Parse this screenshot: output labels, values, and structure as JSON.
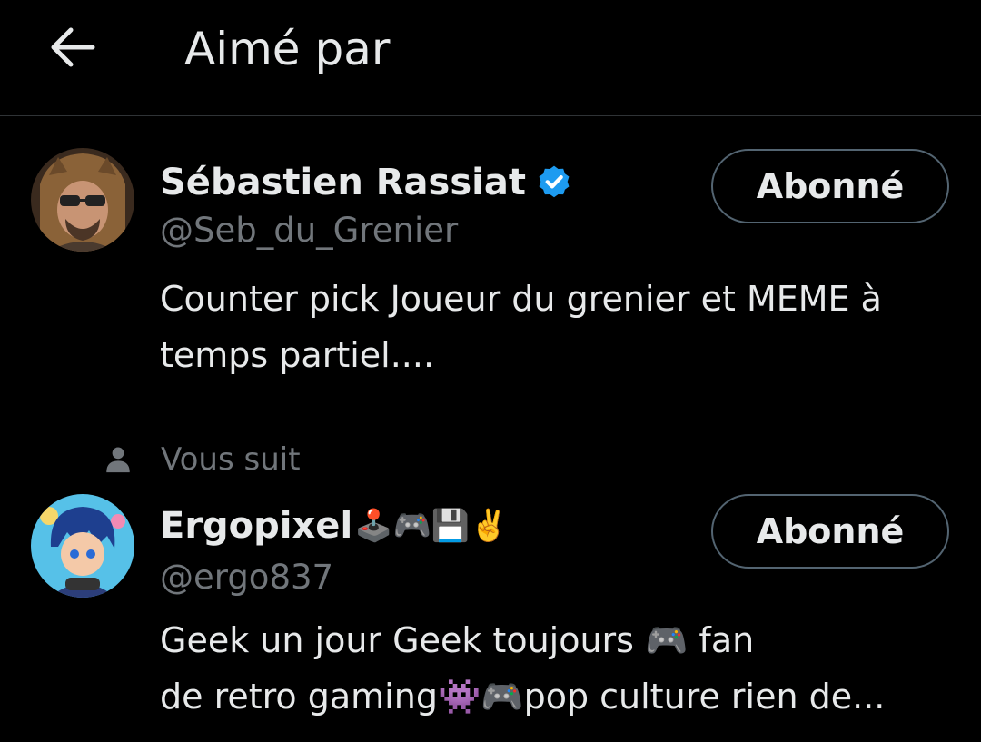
{
  "header": {
    "title": "Aimé par",
    "back_icon": "arrow-left-icon"
  },
  "users": [
    {
      "name": "Sébastien Rassiat",
      "verified": true,
      "handle": "@Seb_du_Grenier",
      "bio": "Counter pick Joueur du grenier et MEME à temps partiel....",
      "follow_label": "Abonné",
      "avatar_icon": "user-avatar"
    },
    {
      "follows_you": "Vous suit",
      "name": "Ergopixel",
      "name_emojis": "🕹️🎮💾✌️",
      "handle": "@ergo837",
      "bio_line1": "Geek un jour Geek toujours 🎮 fan",
      "bio_line2": "de retro gaming👾🎮pop culture rien de...",
      "follow_label": "Abonné",
      "avatar_icon": "user-avatar"
    }
  ],
  "colors": {
    "background": "#000000",
    "primary_text": "#e7e9ea",
    "secondary_text": "#71767b",
    "verified_badge": "#1d9bf0",
    "button_border": "#536471",
    "divider": "#2f3336"
  }
}
